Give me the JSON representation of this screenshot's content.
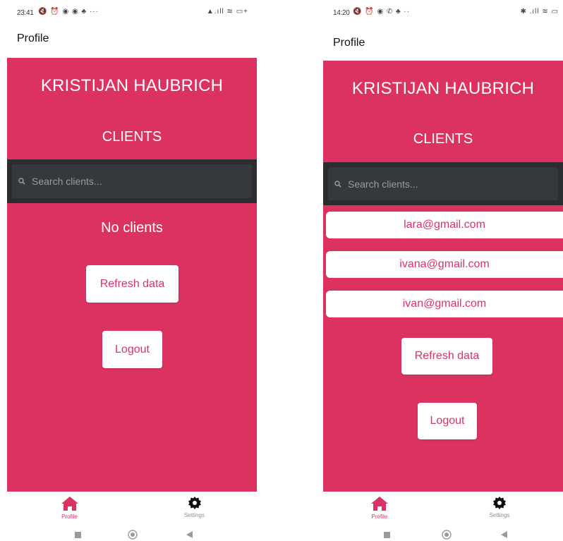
{
  "left": {
    "status": {
      "time": "23:41",
      "left_icons": "🔇 ⏰ ◉ ◉ ♣  ···",
      "right_icons": "▲.ıll ≋ ▭+"
    },
    "app_title": "Profile",
    "user_name": "KRISTIJAN HAUBRICH",
    "clients_heading": "CLIENTS",
    "search": {
      "placeholder": "Search clients..."
    },
    "empty_text": "No clients",
    "refresh_label": "Refresh data",
    "logout_label": "Logout",
    "tabs": [
      {
        "label": "Profile",
        "icon": "home-icon",
        "active": true
      },
      {
        "label": "Settings",
        "icon": "gear-icon",
        "active": false
      }
    ]
  },
  "right": {
    "status": {
      "time": "14:20",
      "left_icons": "🔇 ⏰ ◉ ✆ ♣  ··",
      "right_icons": "✱ .ıll ≋ ▭"
    },
    "app_title": "Profile",
    "user_name": "KRISTIJAN HAUBRICH",
    "clients_heading": "CLIENTS",
    "search": {
      "placeholder": "Search clients..."
    },
    "clients": [
      "lara@gmail.com",
      "ivana@gmail.com",
      "ivan@gmail.com"
    ],
    "refresh_label": "Refresh data",
    "logout_label": "Logout",
    "tabs": [
      {
        "label": "Profile",
        "icon": "home-icon",
        "active": true
      },
      {
        "label": "Settings",
        "icon": "gear-icon",
        "active": false
      }
    ]
  },
  "colors": {
    "accent": "#dc3262",
    "search_bar": "#2b2d31",
    "inactive_tab": "#8e8e93"
  }
}
